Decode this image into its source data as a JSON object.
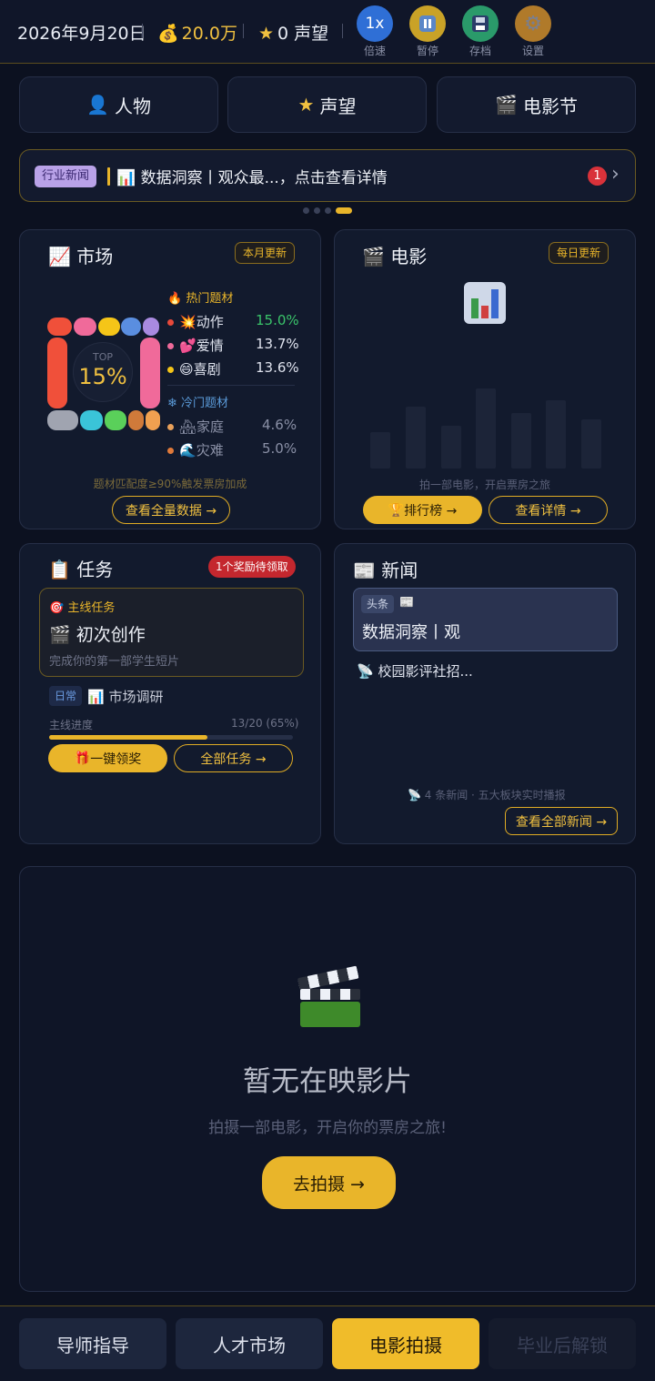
{
  "topbar": {
    "date": "2026年9月20日",
    "money_icon": "money-bag-icon",
    "money": "20.0万",
    "reputation": "0 声望",
    "speed_value": "1x",
    "speed_label": "倍速",
    "pause_label": "暂停",
    "save_label": "存档",
    "settings_label": "设置",
    "colors": {
      "speed": "#2f6fd6",
      "pause": "#c9a227",
      "save": "#2a9a6a",
      "settings": "#b07a2a"
    }
  },
  "tabs": [
    {
      "label": "人物",
      "icon": "person-icon"
    },
    {
      "label": "声望",
      "icon": "star-icon"
    },
    {
      "label": "电影节",
      "icon": "clapperboard-icon"
    }
  ],
  "ticker": {
    "tag": "行业新闻",
    "text": "数据洞察丨观众最...，点击查看详情",
    "badge": "1"
  },
  "market": {
    "title": "市场",
    "tag": "本月更新",
    "top_label": "TOP",
    "top_value": "15%",
    "hot_header": "热门题材",
    "hot": [
      {
        "name": "动作",
        "pct": "15.0%",
        "color": "#e8493a"
      },
      {
        "name": "爱情",
        "pct": "13.7%",
        "color": "#f06a9a"
      },
      {
        "name": "喜剧",
        "pct": "13.6%",
        "color": "#f5c518"
      }
    ],
    "cold_header": "冷门题材",
    "cold": [
      {
        "name": "家庭",
        "pct": "4.6%",
        "color": "#e8a05a"
      },
      {
        "name": "灾难",
        "pct": "5.0%",
        "color": "#e07a3a"
      }
    ],
    "footnote": "题材匹配度≥90%触发票房加成",
    "button": "查看全量数据 →"
  },
  "movies": {
    "title": "电影",
    "tag": "每日更新",
    "empty_text": "拍一部电影，开启票房之旅",
    "rank_button": "排行榜 →",
    "detail_button": "查看详情 →"
  },
  "tasks": {
    "title": "任务",
    "reward_badge": "1个奖励待领取",
    "main_label": "主线任务",
    "main_title": "初次创作",
    "main_desc": "完成你的第一部学生短片",
    "daily_tag": "日常",
    "daily_task": "市场调研",
    "progress_label": "主线进度",
    "progress_text": "13/20 (65%)",
    "progress": 0.65,
    "claim_button": "一键领奖",
    "all_button": "全部任务 →"
  },
  "news": {
    "title": "新闻",
    "headline_tag": "头条",
    "headline": "数据洞察丨观",
    "item": "校园影评社招...",
    "footer": "4 条新闻 · 五大板块实时播报",
    "button": "查看全部新闻 →"
  },
  "now_showing": {
    "empty_title": "暂无在映影片",
    "empty_sub": "拍摄一部电影，开启你的票房之旅!",
    "button": "去拍摄 →"
  },
  "bottom_nav": [
    {
      "label": "导师指导",
      "state": "normal"
    },
    {
      "label": "人才市场",
      "state": "normal"
    },
    {
      "label": "电影拍摄",
      "state": "active"
    },
    {
      "label": "毕业后解锁",
      "state": "disabled"
    }
  ]
}
